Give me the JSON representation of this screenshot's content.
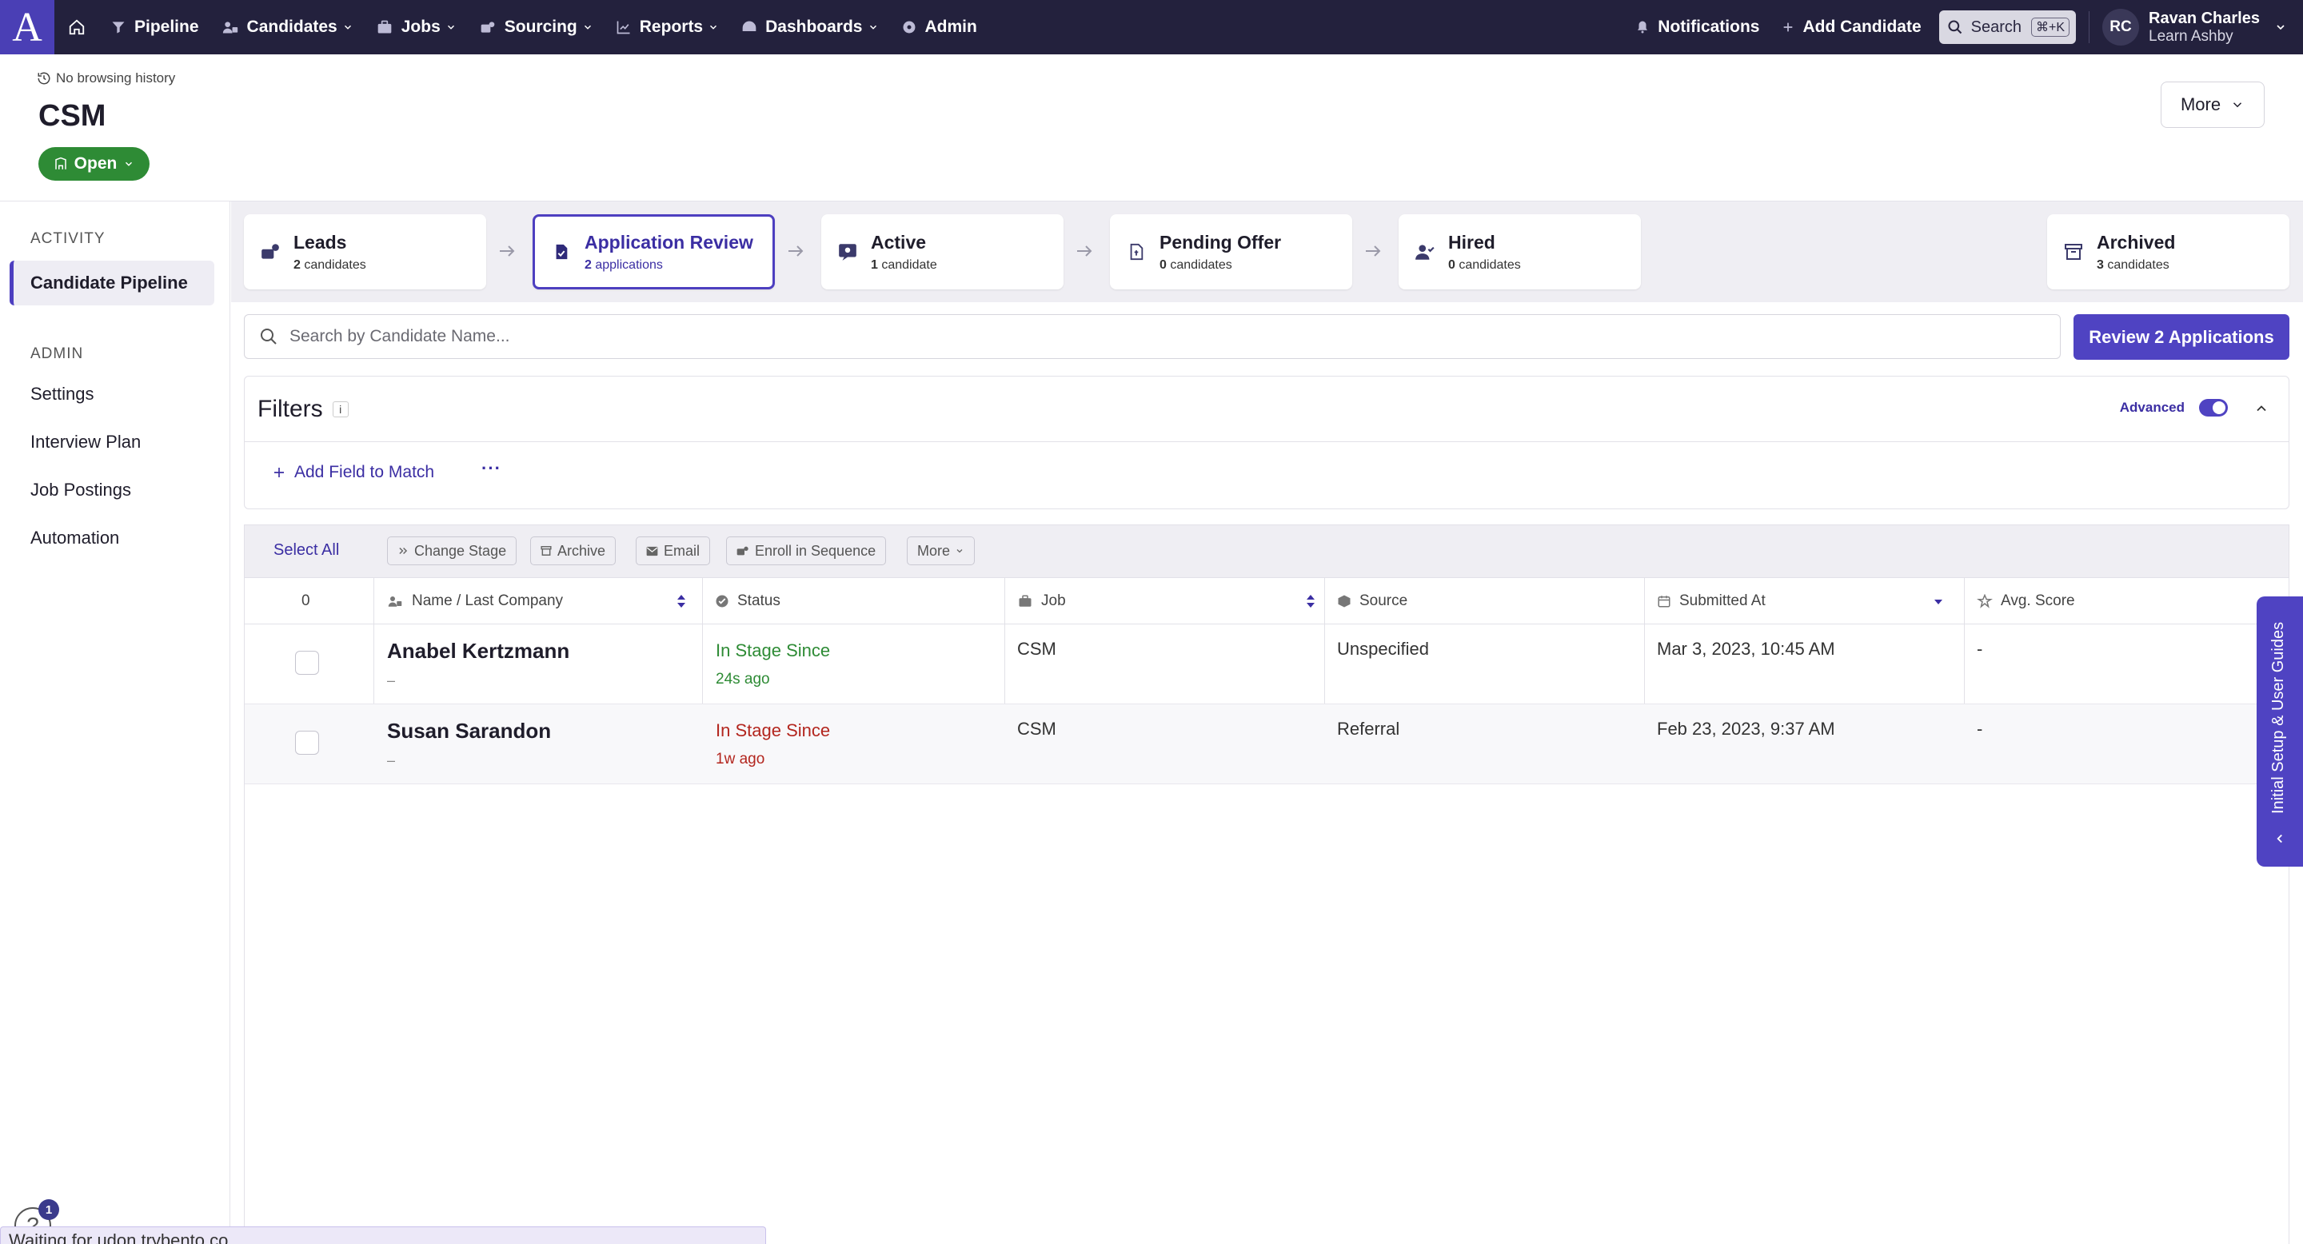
{
  "nav": {
    "logo": "A",
    "items": [
      {
        "label": "Pipeline",
        "icon": "filter-icon",
        "dropdown": false
      },
      {
        "label": "Candidates",
        "icon": "users-icon",
        "dropdown": true
      },
      {
        "label": "Jobs",
        "icon": "briefcase-icon",
        "dropdown": true
      },
      {
        "label": "Sourcing",
        "icon": "sourcing-icon",
        "dropdown": true
      },
      {
        "label": "Reports",
        "icon": "chart-icon",
        "dropdown": true
      },
      {
        "label": "Dashboards",
        "icon": "dashboard-icon",
        "dropdown": true
      },
      {
        "label": "Admin",
        "icon": "gear-icon",
        "dropdown": false
      }
    ],
    "notifications": "Notifications",
    "add_candidate": "Add Candidate",
    "search": "Search",
    "search_shortcut": "⌘+K",
    "user_initials": "RC",
    "user_name": "Ravan Charles",
    "user_org": "Learn Ashby"
  },
  "header": {
    "history": "No browsing history",
    "title": "CSM",
    "status": "Open",
    "more": "More"
  },
  "sidebar": {
    "activity_heading": "ACTIVITY",
    "activity_items": [
      "Candidate Pipeline"
    ],
    "admin_heading": "ADMIN",
    "admin_items": [
      "Settings",
      "Interview Plan",
      "Job Postings",
      "Automation"
    ]
  },
  "stages": [
    {
      "name": "Leads",
      "count": "2",
      "unit": "candidates"
    },
    {
      "name": "Application Review",
      "count": "2",
      "unit": "applications"
    },
    {
      "name": "Active",
      "count": "1",
      "unit": "candidate"
    },
    {
      "name": "Pending Offer",
      "count": "0",
      "unit": "candidates"
    },
    {
      "name": "Hired",
      "count": "0",
      "unit": "candidates"
    },
    {
      "name": "Archived",
      "count": "3",
      "unit": "candidates"
    }
  ],
  "search": {
    "placeholder": "Search by Candidate Name...",
    "review_button": "Review 2 Applications"
  },
  "filters": {
    "title": "Filters",
    "info": "i",
    "advanced": "Advanced",
    "add_field": "Add Field to Match",
    "more": "···"
  },
  "actions": {
    "select_all": "Select All",
    "buttons": [
      "Change Stage",
      "Archive",
      "Email",
      "Enroll in Sequence",
      "More"
    ]
  },
  "table": {
    "selected_count": "0",
    "columns": [
      "Name / Last Company",
      "Status",
      "Job",
      "Source",
      "Submitted At",
      "Avg. Score"
    ],
    "rows": [
      {
        "name": "Anabel Kertzmann",
        "company": "–",
        "status": "In Stage Since",
        "status_time": "24s ago",
        "status_color": "#2e8b35",
        "job": "CSM",
        "source": "Unspecified",
        "submitted": "Mar 3, 2023, 10:45 AM",
        "score": "-"
      },
      {
        "name": "Susan Sarandon",
        "company": "–",
        "status": "In Stage Since",
        "status_time": "1w ago",
        "status_color": "#b3261e",
        "job": "CSM",
        "source": "Referral",
        "submitted": "Feb 23, 2023, 9:37 AM",
        "score": "-"
      }
    ]
  },
  "guide_tab": "Initial Setup & User Guides",
  "status_bar": "Waiting for udon.trybento.co...",
  "help": {
    "icon": "?",
    "badge": "1"
  },
  "colors": {
    "nav_bg": "#23213d",
    "brand": "#4f43c2",
    "open_green": "#2e8b35"
  }
}
